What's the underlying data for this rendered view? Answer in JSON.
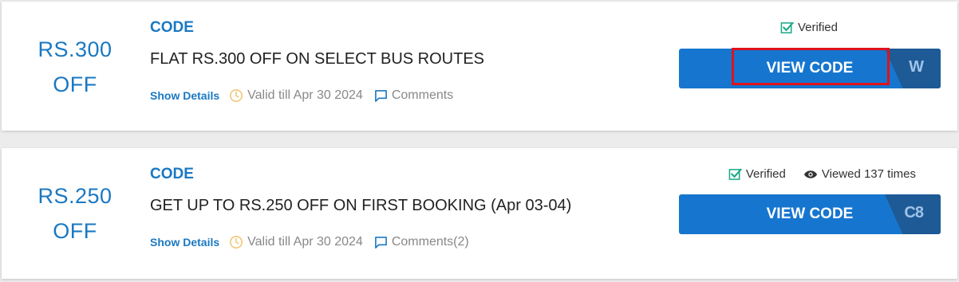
{
  "coupons": [
    {
      "amount_line1": "RS.300",
      "amount_line2": "OFF",
      "type": "CODE",
      "title": "FLAT RS.300 OFF ON SELECT BUS ROUTES",
      "show_details": "Show Details",
      "valid": "Valid till Apr 30 2024",
      "comments": "Comments",
      "verified": "Verified",
      "button_label": "VIEW CODE",
      "code_peek": "W"
    },
    {
      "amount_line1": "RS.250",
      "amount_line2": "OFF",
      "type": "CODE",
      "title": "GET UP TO RS.250 OFF ON FIRST BOOKING (Apr 03-04)",
      "show_details": "Show Details",
      "valid": "Valid till Apr 30 2024",
      "comments": "Comments(2)",
      "verified": "Verified",
      "views": "Viewed 137 times",
      "button_label": "VIEW CODE",
      "code_peek": "C8"
    }
  ],
  "colors": {
    "accent": "#1a78c2",
    "button": "#1676cf",
    "verified_green": "#1aa886",
    "clock_yellow": "#f0c878",
    "highlight_red": "#e0121b"
  },
  "icons": [
    "clock-icon",
    "comment-icon",
    "verified-check-icon",
    "eye-icon"
  ]
}
